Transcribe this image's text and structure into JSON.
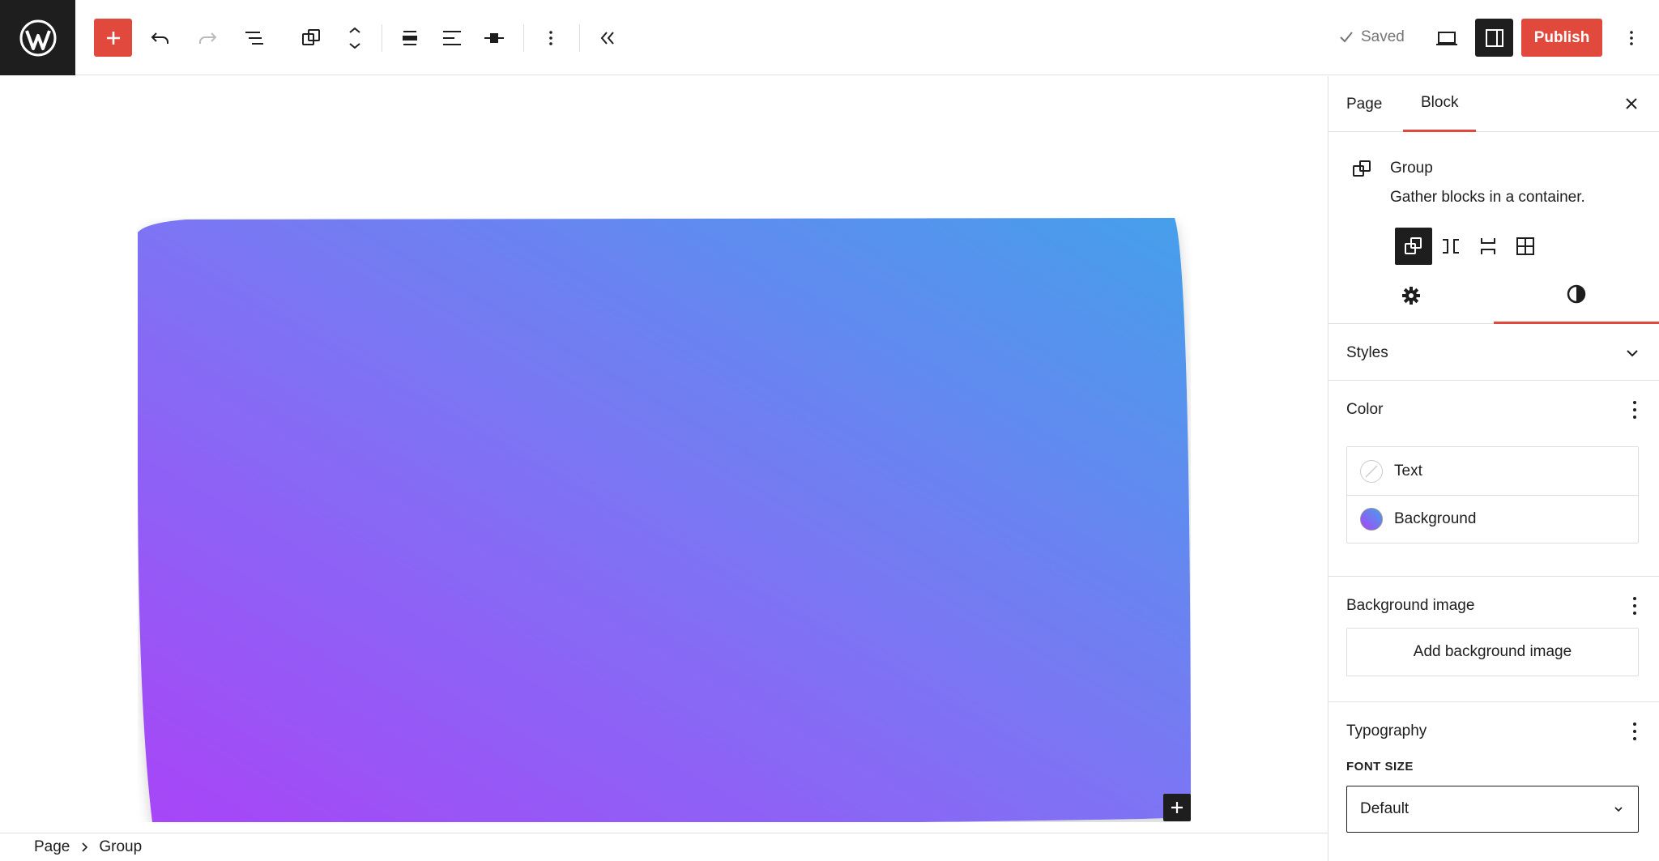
{
  "toolbar": {
    "saved_label": "Saved",
    "publish_label": "Publish"
  },
  "colors": {
    "accent": "#e2493d",
    "dark": "#1e1e1e",
    "gradient_start": "#a845f7",
    "gradient_end": "#45a0eb"
  },
  "breadcrumb": {
    "root": "Page",
    "current": "Group"
  },
  "sidebar": {
    "tabs": [
      {
        "label": "Page"
      },
      {
        "label": "Block"
      }
    ],
    "block": {
      "title": "Group",
      "description": "Gather blocks in a container."
    },
    "styles": {
      "heading": "Styles"
    },
    "color": {
      "heading": "Color",
      "items": [
        {
          "label": "Text"
        },
        {
          "label": "Background"
        }
      ]
    },
    "background_image": {
      "heading": "Background image",
      "button": "Add background image"
    },
    "typography": {
      "heading": "Typography",
      "font_size_label": "FONT SIZE",
      "font_size_value": "Default"
    }
  }
}
